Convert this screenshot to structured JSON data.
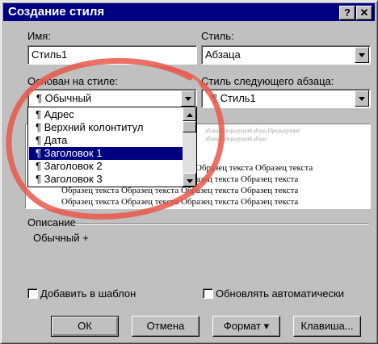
{
  "window": {
    "title": "Создание стиля",
    "help_button": "?",
    "close_button": "✕"
  },
  "name": {
    "label": "Имя:",
    "value": "Стиль1"
  },
  "style_type": {
    "label": "Стиль:",
    "value": "Абзаца"
  },
  "based_on": {
    "label": "Основан на стиле:",
    "value": "¶ Обычный",
    "options": [
      "¶ Адрес",
      "¶ Верхний колонтитул",
      "¶ Дата",
      "¶ Заголовок 1",
      "¶ Заголовок 2",
      "¶ Заголовок 3"
    ],
    "selected_index": 3
  },
  "next_style": {
    "label": "Стиль следующего абзаца:",
    "value": "¶ Стиль1"
  },
  "preview": {
    "gray_lines": [
      "абзац Предыдущий абзац Предыдущий",
      "абзац Предыдущий абзац"
    ],
    "sample_lines": [
      "Образец текста Образец текста",
      "Образец текста Образец текста Образец текста Образец текста",
      "Образец текста Образец текста Образец текста Образец текста",
      "Образец текста Образец текста Образец текста Образец текста"
    ]
  },
  "description": {
    "label": "Описание",
    "value": "Обычный +"
  },
  "checkboxes": {
    "add_to_template": "Добавить в шаблон",
    "auto_update": "Обновлять автоматически"
  },
  "buttons": {
    "ok": "ОК",
    "cancel": "Отмена",
    "format": "Формат ▾",
    "shortcut": "Клавиша..."
  },
  "colors": {
    "title_bar": "#000080",
    "selection": "#000080",
    "annotation_circle": "#e8584c"
  }
}
